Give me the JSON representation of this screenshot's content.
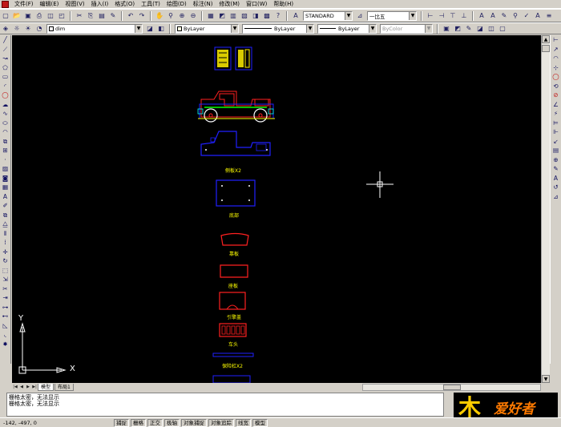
{
  "menubar": {
    "items": [
      "文件(F)",
      "编辑(E)",
      "视图(V)",
      "插入(I)",
      "格式(O)",
      "工具(T)",
      "绘图(D)",
      "标注(N)",
      "修改(M)",
      "窗口(W)",
      "帮助(H)"
    ]
  },
  "toolbar1": {
    "text_style": "STANDARD",
    "dim_style": "一比五"
  },
  "toolbar2": {
    "layer": "dim",
    "color": "ByLayer",
    "linetype": "ByLayer",
    "lineweight": "ByLayer",
    "plotstyle": "ByColor"
  },
  "drawing": {
    "labels": [
      "侧板X2",
      "底部",
      "靠板",
      "座板",
      "引擎盖",
      "车头",
      "保险杠X2"
    ],
    "cursor_color": "#ffffff",
    "ucs": {
      "y_label": "Y",
      "x_label": "X"
    }
  },
  "tabs": [
    "模型",
    "布局1"
  ],
  "command": {
    "lines": [
      "栅格太密，无法显示",
      "栅格太密，无法显示"
    ]
  },
  "status": {
    "coords": "-142, -497, 0",
    "modes": [
      "捕捉",
      "栅格",
      "正交",
      "极轴",
      "对象捕捉",
      "对象追踪",
      "线宽",
      "模型"
    ]
  },
  "logo": {
    "char1": "木",
    "char2": "爱好者"
  },
  "colors": {
    "canvas": "#000000",
    "outline_blue": "#2020ff",
    "outline_red": "#ff2020",
    "label_yellow": "#ffff00",
    "green": "#00ff00"
  }
}
